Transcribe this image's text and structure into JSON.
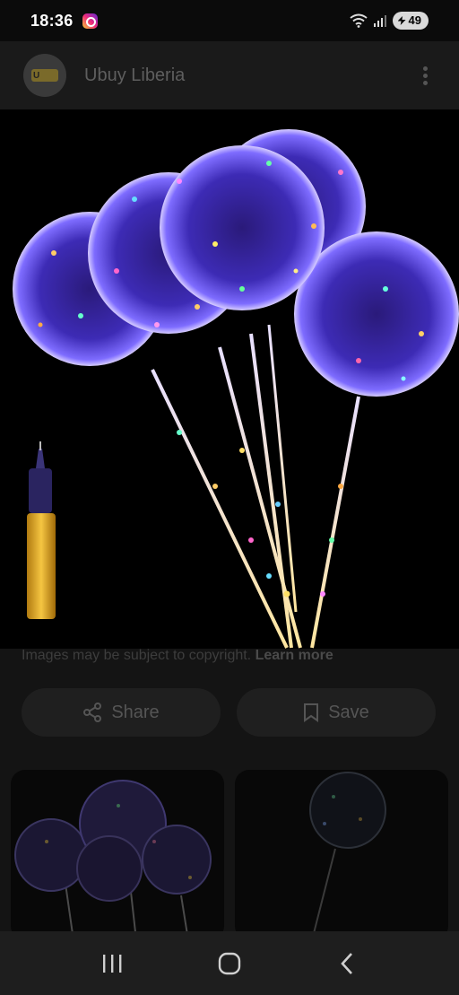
{
  "status_bar": {
    "time": "18:36",
    "battery": "49"
  },
  "header": {
    "site_name": "Ubuy Liberia",
    "logo_text": "Ubuy"
  },
  "image": {
    "description": "LED light-up bubble balloons with pump"
  },
  "copyright": {
    "text": "Images may be subject to copyright. ",
    "learn_more": "Learn more"
  },
  "actions": {
    "share_label": "Share",
    "save_label": "Save"
  },
  "colors": {
    "accent": "#6a4cff",
    "glow": "#b59cff",
    "bg": "#000000"
  },
  "nav": {
    "recents_icon": "recent-apps-icon",
    "home_icon": "home-icon",
    "back_icon": "back-icon"
  }
}
